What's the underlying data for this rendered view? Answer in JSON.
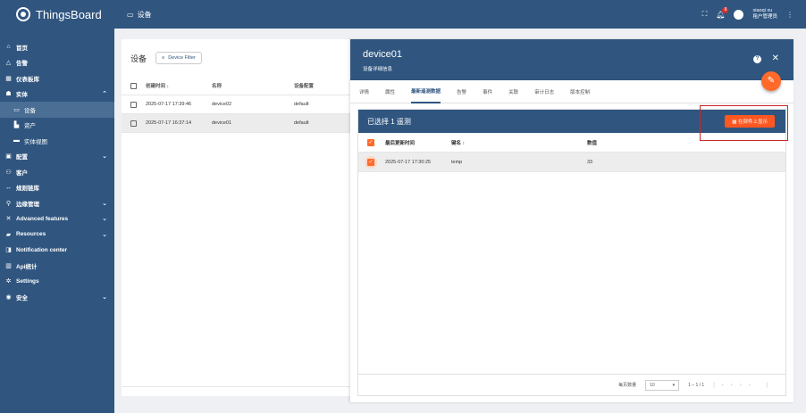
{
  "app": {
    "name": "ThingsBoard"
  },
  "topbar": {
    "title": "设备",
    "notification_count": "8",
    "user_name": "xiaoqi xu",
    "user_role": "租户管理员"
  },
  "nav": [
    {
      "label": "首页",
      "icon": "home-icon"
    },
    {
      "label": "告警",
      "icon": "warning-icon"
    },
    {
      "label": "仪表板库",
      "icon": "dashboard-icon"
    },
    {
      "label": "实体",
      "icon": "entities-icon"
    },
    {
      "label": "设备",
      "icon": "device-icon"
    },
    {
      "label": "资产",
      "icon": "asset-icon"
    },
    {
      "label": "实体视图",
      "icon": "entity-view-icon"
    },
    {
      "label": "配置",
      "icon": "profiles-icon"
    },
    {
      "label": "客户",
      "icon": "customers-icon"
    },
    {
      "label": "规则链库",
      "icon": "rule-chain-icon"
    },
    {
      "label": "边缘管理",
      "icon": "edge-icon"
    },
    {
      "label": "Advanced features",
      "icon": "advanced-icon"
    },
    {
      "label": "Resources",
      "icon": "resources-icon"
    },
    {
      "label": "Notification center",
      "icon": "notification-icon"
    },
    {
      "label": "Api统计",
      "icon": "api-icon"
    },
    {
      "label": "Settings",
      "icon": "settings-icon"
    },
    {
      "label": "安全",
      "icon": "security-icon"
    }
  ],
  "device_list": {
    "title": "设备",
    "filter_label": "Device Filter",
    "columns": [
      "创建时间 ↓",
      "名称",
      "设备配置"
    ],
    "rows": [
      {
        "time": "2025-07-17 17:39:46",
        "name": "device02",
        "profile": "default"
      },
      {
        "time": "2025-07-17 16:37:14",
        "name": "device01",
        "profile": "default"
      }
    ]
  },
  "details": {
    "name": "device01",
    "subtitle": "设备详细信息",
    "tabs": [
      "详情",
      "属性",
      "最新遥测数据",
      "告警",
      "事件",
      "关联",
      "审计日志",
      "版本控制"
    ],
    "selection_text": "已选择 1 遥测",
    "show_widget_label": "在部件上显示",
    "columns": [
      "最后更新时间",
      "键名 ↑",
      "数值"
    ],
    "rows": [
      {
        "time": "2025-07-17 17:30:25",
        "key": "temp",
        "value": "33"
      }
    ],
    "pager": {
      "per_page_label": "每页数量",
      "per_page": "10",
      "range": "1 – 1 / 1"
    }
  }
}
